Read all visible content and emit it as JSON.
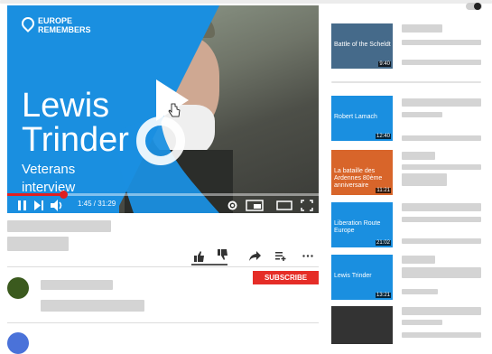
{
  "player": {
    "brand_line1": "EUROPE",
    "brand_line2": "REMEMBERS",
    "title_line1": "Lewis",
    "title_line2": "Trinder",
    "subtitle_line1": "Veterans",
    "subtitle_line2": "interview",
    "time_display": "1:45 / 31:29",
    "progress": 0.18,
    "colors": {
      "brand_blue": "#1a8fe0",
      "progress_red": "#e02020"
    },
    "icons": [
      "play-icon",
      "pause-icon",
      "next-icon",
      "volume-icon",
      "settings-icon",
      "miniplayer-icon",
      "theater-icon",
      "fullscreen-icon"
    ]
  },
  "actions": {
    "icons": [
      "like-icon",
      "dislike-icon",
      "share-icon",
      "save-icon",
      "more-icon"
    ]
  },
  "subscribe_label": "SUBSCRIBE",
  "sidebar": {
    "thumbs": [
      {
        "title": "Battle of the Scheldt",
        "duration": "9:40",
        "bg": "#456a8a"
      },
      {
        "title": "Robert Lamach",
        "duration": "12:40",
        "bg": "#1a8fe0"
      },
      {
        "title": "La bataille des Ardennes 80ème anniversaire",
        "duration": "11:21",
        "bg": "#d8652a"
      },
      {
        "title": "Liberation Route Europe",
        "duration": "21:02",
        "bg": "#1a8fe0"
      },
      {
        "title": "Lewis Trinder",
        "duration": "13:21",
        "bg": "#1a8fe0"
      },
      {
        "title": "",
        "duration": "",
        "bg": "#333333"
      }
    ]
  }
}
